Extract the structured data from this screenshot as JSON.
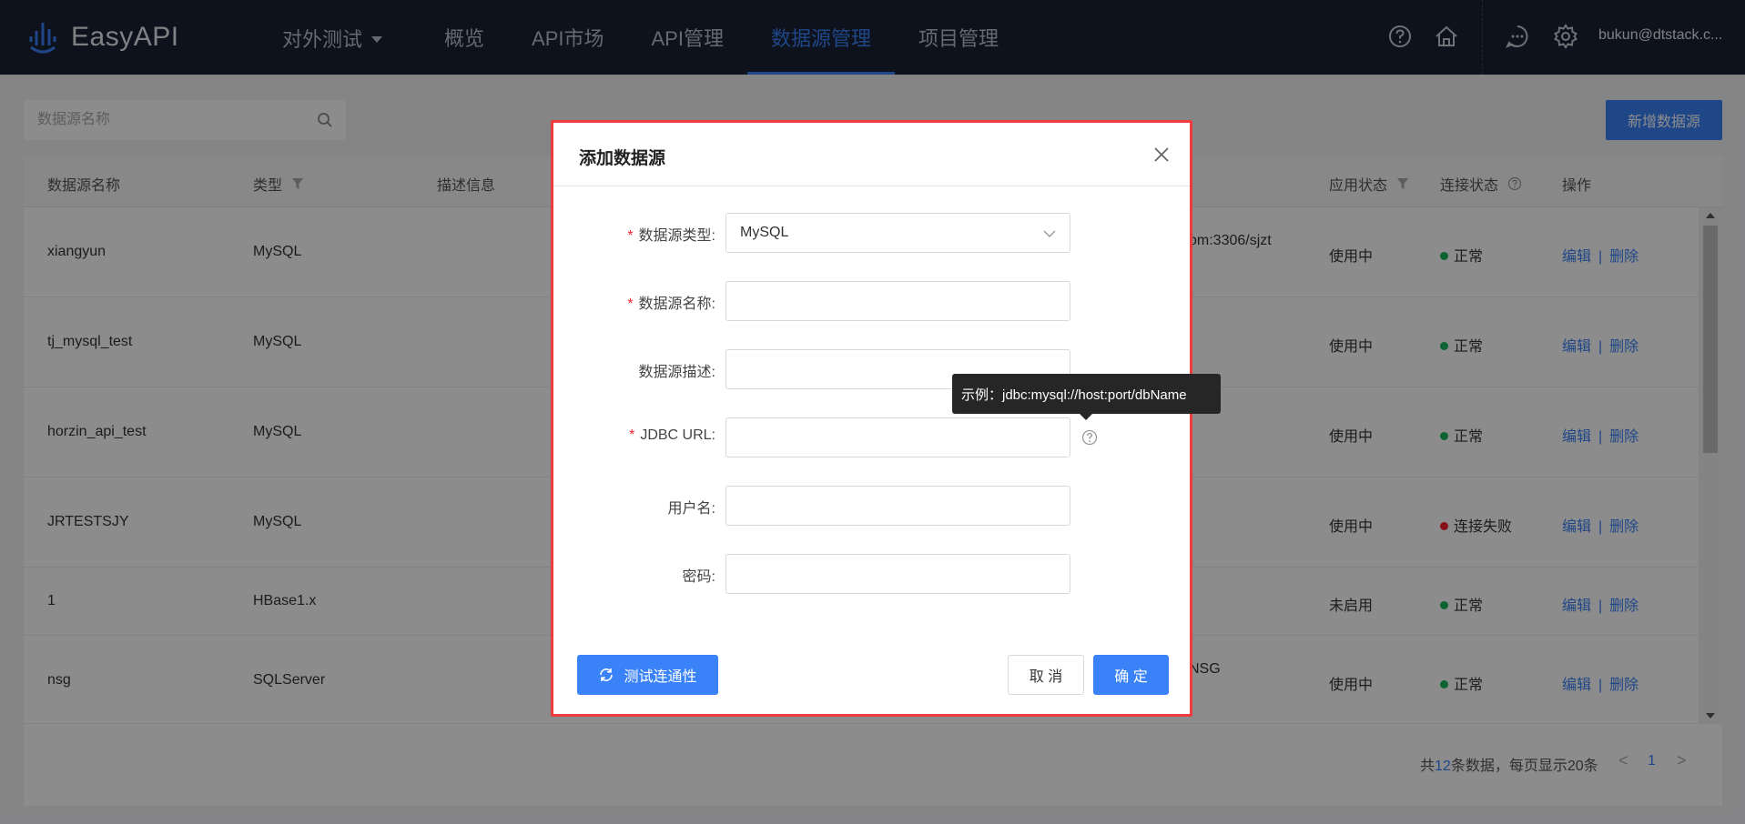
{
  "header": {
    "logo_text": "EasyAPI",
    "project": "对外测试",
    "nav": [
      {
        "label": "概览"
      },
      {
        "label": "API市场"
      },
      {
        "label": "API管理"
      },
      {
        "label": "数据源管理",
        "active": true
      },
      {
        "label": "项目管理"
      }
    ],
    "user_email": "bukun@dtstack.c..."
  },
  "toolbar": {
    "search_placeholder": "数据源名称",
    "add_label": "新增数据源"
  },
  "table": {
    "columns": [
      "数据源名称",
      "类型",
      "描述信息",
      "应用状态",
      "连接状态",
      "操作"
    ],
    "rows": [
      {
        "name": "xiangyun",
        "type": "MySQL",
        "url_fragment": "om:3306/sjzt",
        "app_status": "使用中",
        "conn_status": "正常",
        "conn_ok": true
      },
      {
        "name": "tj_mysql_test",
        "type": "MySQL",
        "url_fragment": "",
        "app_status": "使用中",
        "conn_status": "正常",
        "conn_ok": true
      },
      {
        "name": "horzin_api_test",
        "type": "MySQL",
        "url_fragment": "",
        "app_status": "使用中",
        "conn_status": "正常",
        "conn_ok": true
      },
      {
        "name": "JRTESTSJY",
        "type": "MySQL",
        "url_fragment": "",
        "app_status": "使用中",
        "conn_status": "连接失败",
        "conn_ok": false
      },
      {
        "name": "1",
        "type": "HBase1.x",
        "url_fragment": "",
        "app_status": "未启用",
        "conn_status": "正常",
        "conn_ok": true
      },
      {
        "name": "nsg",
        "type": "SQLServer",
        "url_fragment": "NSG",
        "app_status": "使用中",
        "conn_status": "正常",
        "conn_ok": true
      }
    ],
    "edit_label": "编辑",
    "delete_label": "删除",
    "sep": "|"
  },
  "pagination": {
    "prefix": "共",
    "total": "12",
    "suffix": "条数据，每页显示20条",
    "prev": "<",
    "page": "1",
    "next": ">"
  },
  "modal": {
    "title": "添加数据源",
    "fields": {
      "type": {
        "label": "数据源类型:",
        "value": "MySQL",
        "required": true
      },
      "name": {
        "label": "数据源名称:",
        "value": "",
        "required": true
      },
      "desc": {
        "label": "数据源描述:",
        "value": "",
        "required": false
      },
      "jdbc": {
        "label": "JDBC URL:",
        "value": "",
        "required": true
      },
      "user": {
        "label": "用户名:",
        "value": "",
        "required": false
      },
      "pwd": {
        "label": "密码:",
        "value": "",
        "required": false
      }
    },
    "required_mark": "*",
    "tooltip": "示例：jdbc:mysql://host:port/dbName",
    "test_label": "测试连通性",
    "cancel_label": "取 消",
    "ok_label": "确 定"
  },
  "colors": {
    "accent": "#3a82f7",
    "nav_bg": "#1a2233",
    "status_ok": "#18b55a",
    "status_fail": "#f5222d",
    "modal_border": "#ee3b3b"
  }
}
